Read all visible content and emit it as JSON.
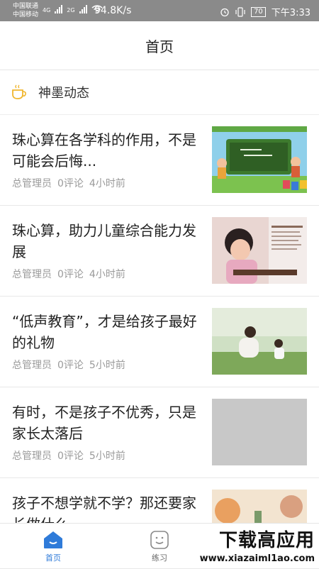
{
  "status": {
    "carrier1": "中国联通",
    "carrier2": "中国移动",
    "net1": "4G",
    "net2": "2G",
    "speed": "94.8K/s",
    "battery": "70",
    "time": "下午3:33"
  },
  "header": {
    "title": "首页"
  },
  "section": {
    "title": "神墨动态",
    "icon": "coffee-cup-icon"
  },
  "articles": [
    {
      "title": "珠心算在各学科的作用，不是可能会后悔...",
      "author": "总管理员",
      "comments": "0评论",
      "time": "4小时前"
    },
    {
      "title": "珠心算，助力儿童综合能力发展",
      "author": "总管理员",
      "comments": "0评论",
      "time": "4小时前"
    },
    {
      "title": "“低声教育”，才是给孩子最好的礼物",
      "author": "总管理员",
      "comments": "0评论",
      "time": "5小时前"
    },
    {
      "title": "有时，不是孩子不优秀，只是家长太落后",
      "author": "总管理员",
      "comments": "0评论",
      "time": "5小时前"
    },
    {
      "title": "孩子不想学就不学？那还要家长做什么",
      "author": "",
      "comments": "",
      "time": ""
    }
  ],
  "tabs": [
    {
      "label": "首页",
      "icon": "home-icon",
      "active": true
    },
    {
      "label": "练习",
      "icon": "smile-icon",
      "active": false
    }
  ],
  "watermark": {
    "line1": "下载高应用",
    "line2": "www.xiazaiml1ao.com"
  },
  "colors": {
    "accent": "#2f7bd9",
    "meta": "#9a9a9a",
    "statusbar": "#8a8a8a"
  }
}
